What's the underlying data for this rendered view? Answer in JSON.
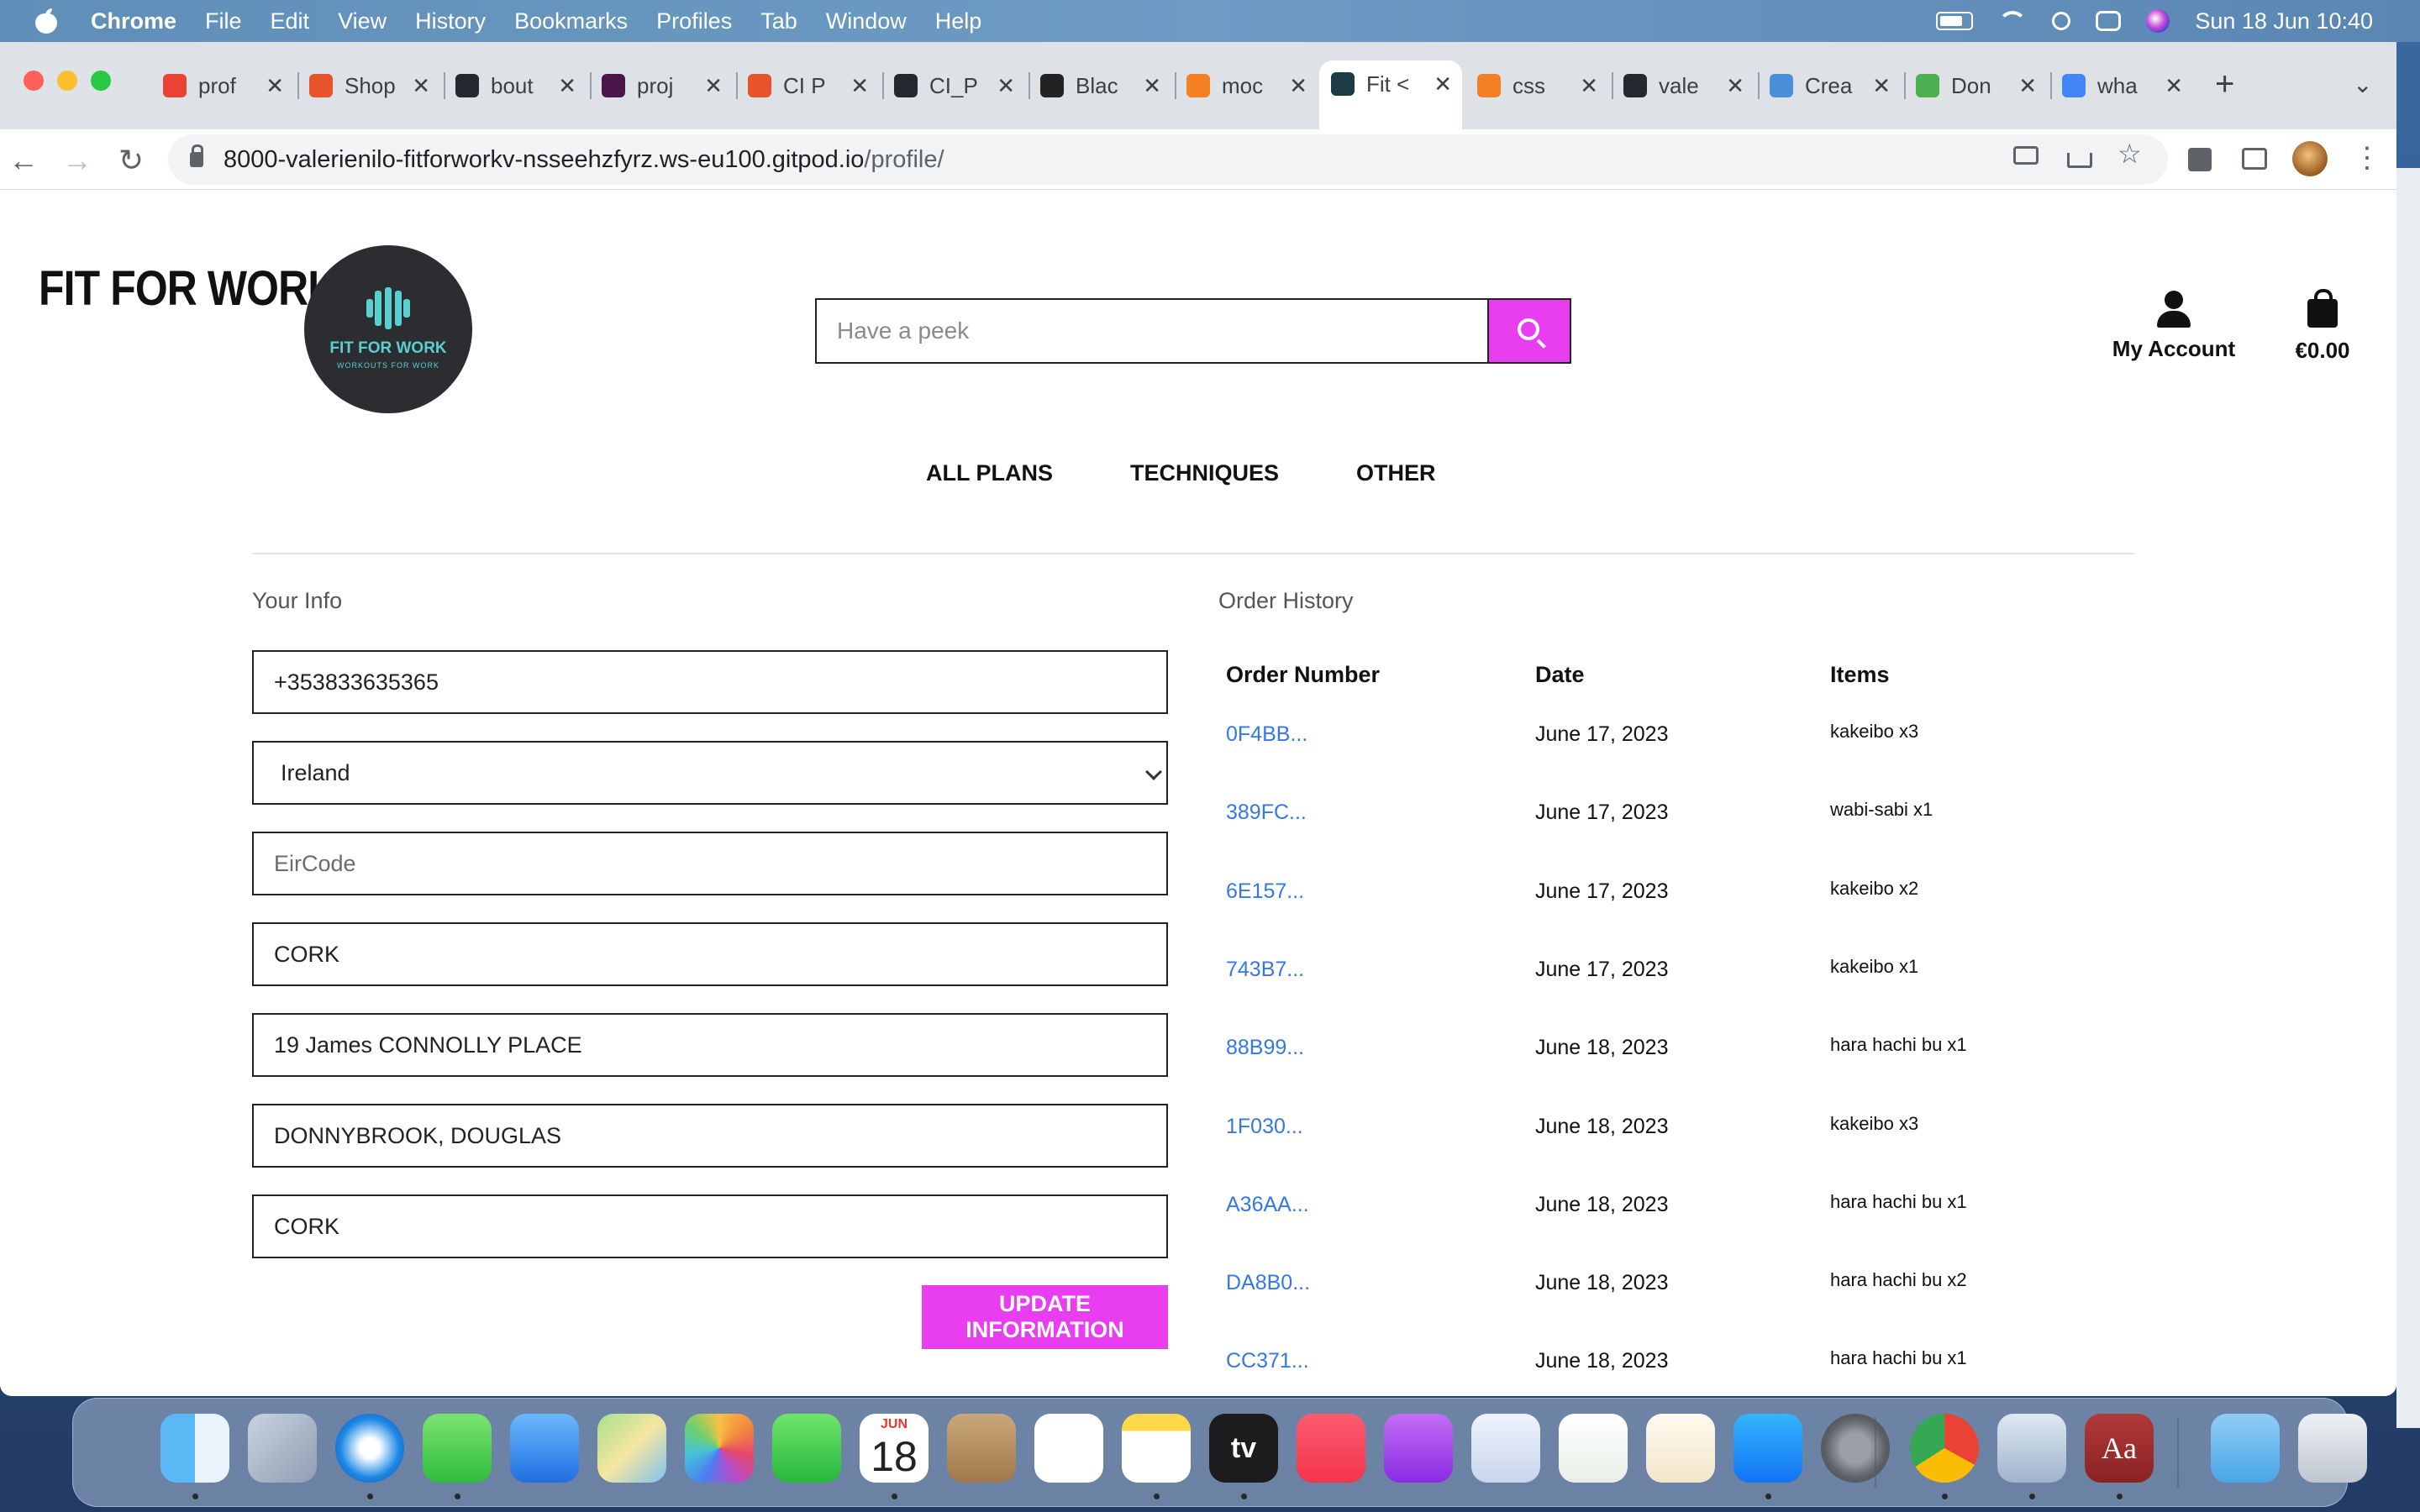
{
  "menubar": {
    "app_name": "Chrome",
    "items": [
      "File",
      "Edit",
      "View",
      "History",
      "Bookmarks",
      "Profiles",
      "Tab",
      "Window",
      "Help"
    ],
    "clock": "Sun 18 Jun  10:40"
  },
  "tabs": [
    {
      "label": "prof",
      "color": "#ea4335"
    },
    {
      "label": "Shop",
      "color": "#e8542a"
    },
    {
      "label": "bout",
      "color": "#24292f"
    },
    {
      "label": "proj",
      "color": "#4a154b"
    },
    {
      "label": "CI P",
      "color": "#e8542a"
    },
    {
      "label": "CI_P",
      "color": "#24292f"
    },
    {
      "label": "Blac",
      "color": "#222222"
    },
    {
      "label": "moc",
      "color": "#f48024"
    },
    {
      "label": "Fit <",
      "color": "#1d3b44",
      "active": true
    },
    {
      "label": "css",
      "color": "#f48024"
    },
    {
      "label": "vale",
      "color": "#24292f"
    },
    {
      "label": "Crea",
      "color": "#4a90d9"
    },
    {
      "label": "Don",
      "color": "#4caf50"
    },
    {
      "label": "wha",
      "color": "#4285f4"
    }
  ],
  "address_bar": {
    "host": "8000-valerienilo-fitforworkv-nsseehzfyrz.ws-eu100.gitpod.io",
    "path": "/profile/"
  },
  "site": {
    "brand": "FIT FOR WORK",
    "logo_title": "FIT FOR WORK",
    "logo_tagline": "WORKOUTS FOR WORK",
    "search_placeholder": "Have a peek",
    "account_label": "My Account",
    "bag_total": "€0.00",
    "nav": [
      "ALL PLANS",
      "TECHNIQUES",
      "OTHER"
    ],
    "accent_color": "#e83ef0"
  },
  "profile": {
    "section_title": "Your Info",
    "phone": "+353833635365",
    "country": "Ireland",
    "postcode_placeholder": "EirCode",
    "town": "CORK",
    "street1": "19 James CONNOLLY PLACE",
    "street2": "DONNYBROOK, DOUGLAS",
    "county": "CORK",
    "update_button": "UPDATE INFORMATION"
  },
  "orders": {
    "section_title": "Order History",
    "columns": [
      "Order Number",
      "Date",
      "Items"
    ],
    "rows": [
      {
        "number": "0F4BB...",
        "date": "June 17, 2023",
        "items": "kakeibo x3"
      },
      {
        "number": "389FC...",
        "date": "June 17, 2023",
        "items": "wabi-sabi x1"
      },
      {
        "number": "6E157...",
        "date": "June 17, 2023",
        "items": "kakeibo x2"
      },
      {
        "number": "743B7...",
        "date": "June 17, 2023",
        "items": "kakeibo x1"
      },
      {
        "number": "88B99...",
        "date": "June 18, 2023",
        "items": "hara hachi bu x1"
      },
      {
        "number": "1F030...",
        "date": "June 18, 2023",
        "items": "kakeibo x3"
      },
      {
        "number": "A36AA...",
        "date": "June 18, 2023",
        "items": "hara hachi bu x1"
      },
      {
        "number": "DA8B0...",
        "date": "June 18, 2023",
        "items": "hara hachi bu x2"
      },
      {
        "number": "CC371...",
        "date": "June 18, 2023",
        "items": "hara hachi bu x1"
      }
    ]
  },
  "dock": {
    "calendar_month": "JUN",
    "calendar_day": "18",
    "apps": [
      "finder-icon",
      "launchpad-icon",
      "safari-icon",
      "messages-icon",
      "mail-icon",
      "maps-icon",
      "photos-icon",
      "facetime-icon",
      "calendar-icon",
      "contacts-icon",
      "reminders-icon",
      "notes-icon",
      "apple-tv-icon",
      "music-icon",
      "podcasts-icon",
      "keynote-icon",
      "numbers-icon",
      "pages-icon",
      "app-store-icon",
      "system-preferences-icon",
      "chrome-icon",
      "preview-icon",
      "dictionary-icon",
      "downloads-folder-icon",
      "trash-icon"
    ],
    "tv_label": "tv",
    "dictionary_label": "Aa"
  }
}
